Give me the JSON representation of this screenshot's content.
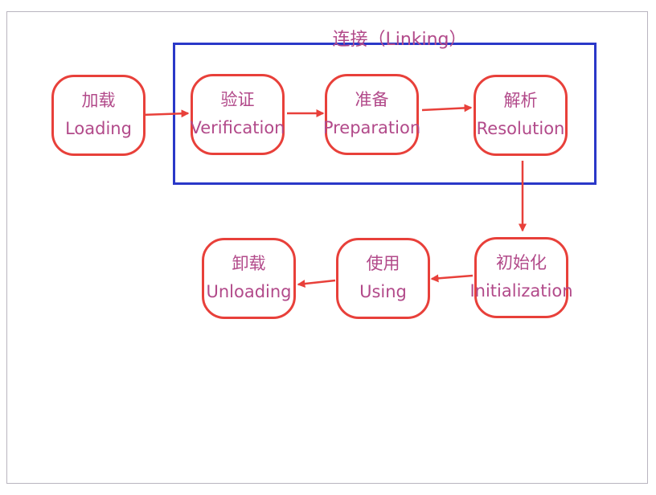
{
  "linking": {
    "title": "连接（Linking）"
  },
  "nodes": {
    "loading": {
      "zh": "加载",
      "en": "Loading"
    },
    "verification": {
      "zh": "验证",
      "en": "Verification"
    },
    "preparation": {
      "zh": "准备",
      "en": "Preparation"
    },
    "resolution": {
      "zh": "解析",
      "en": "Resolution"
    },
    "initialization": {
      "zh": "初始化",
      "en": "Initialization"
    },
    "using": {
      "zh": "使用",
      "en": "Using"
    },
    "unloading": {
      "zh": "卸载",
      "en": "Unloading"
    }
  },
  "colors": {
    "node_border": "#e8403a",
    "arrow": "#e8403a",
    "linking_box": "#2a38c8",
    "text": "#b24a8a"
  }
}
